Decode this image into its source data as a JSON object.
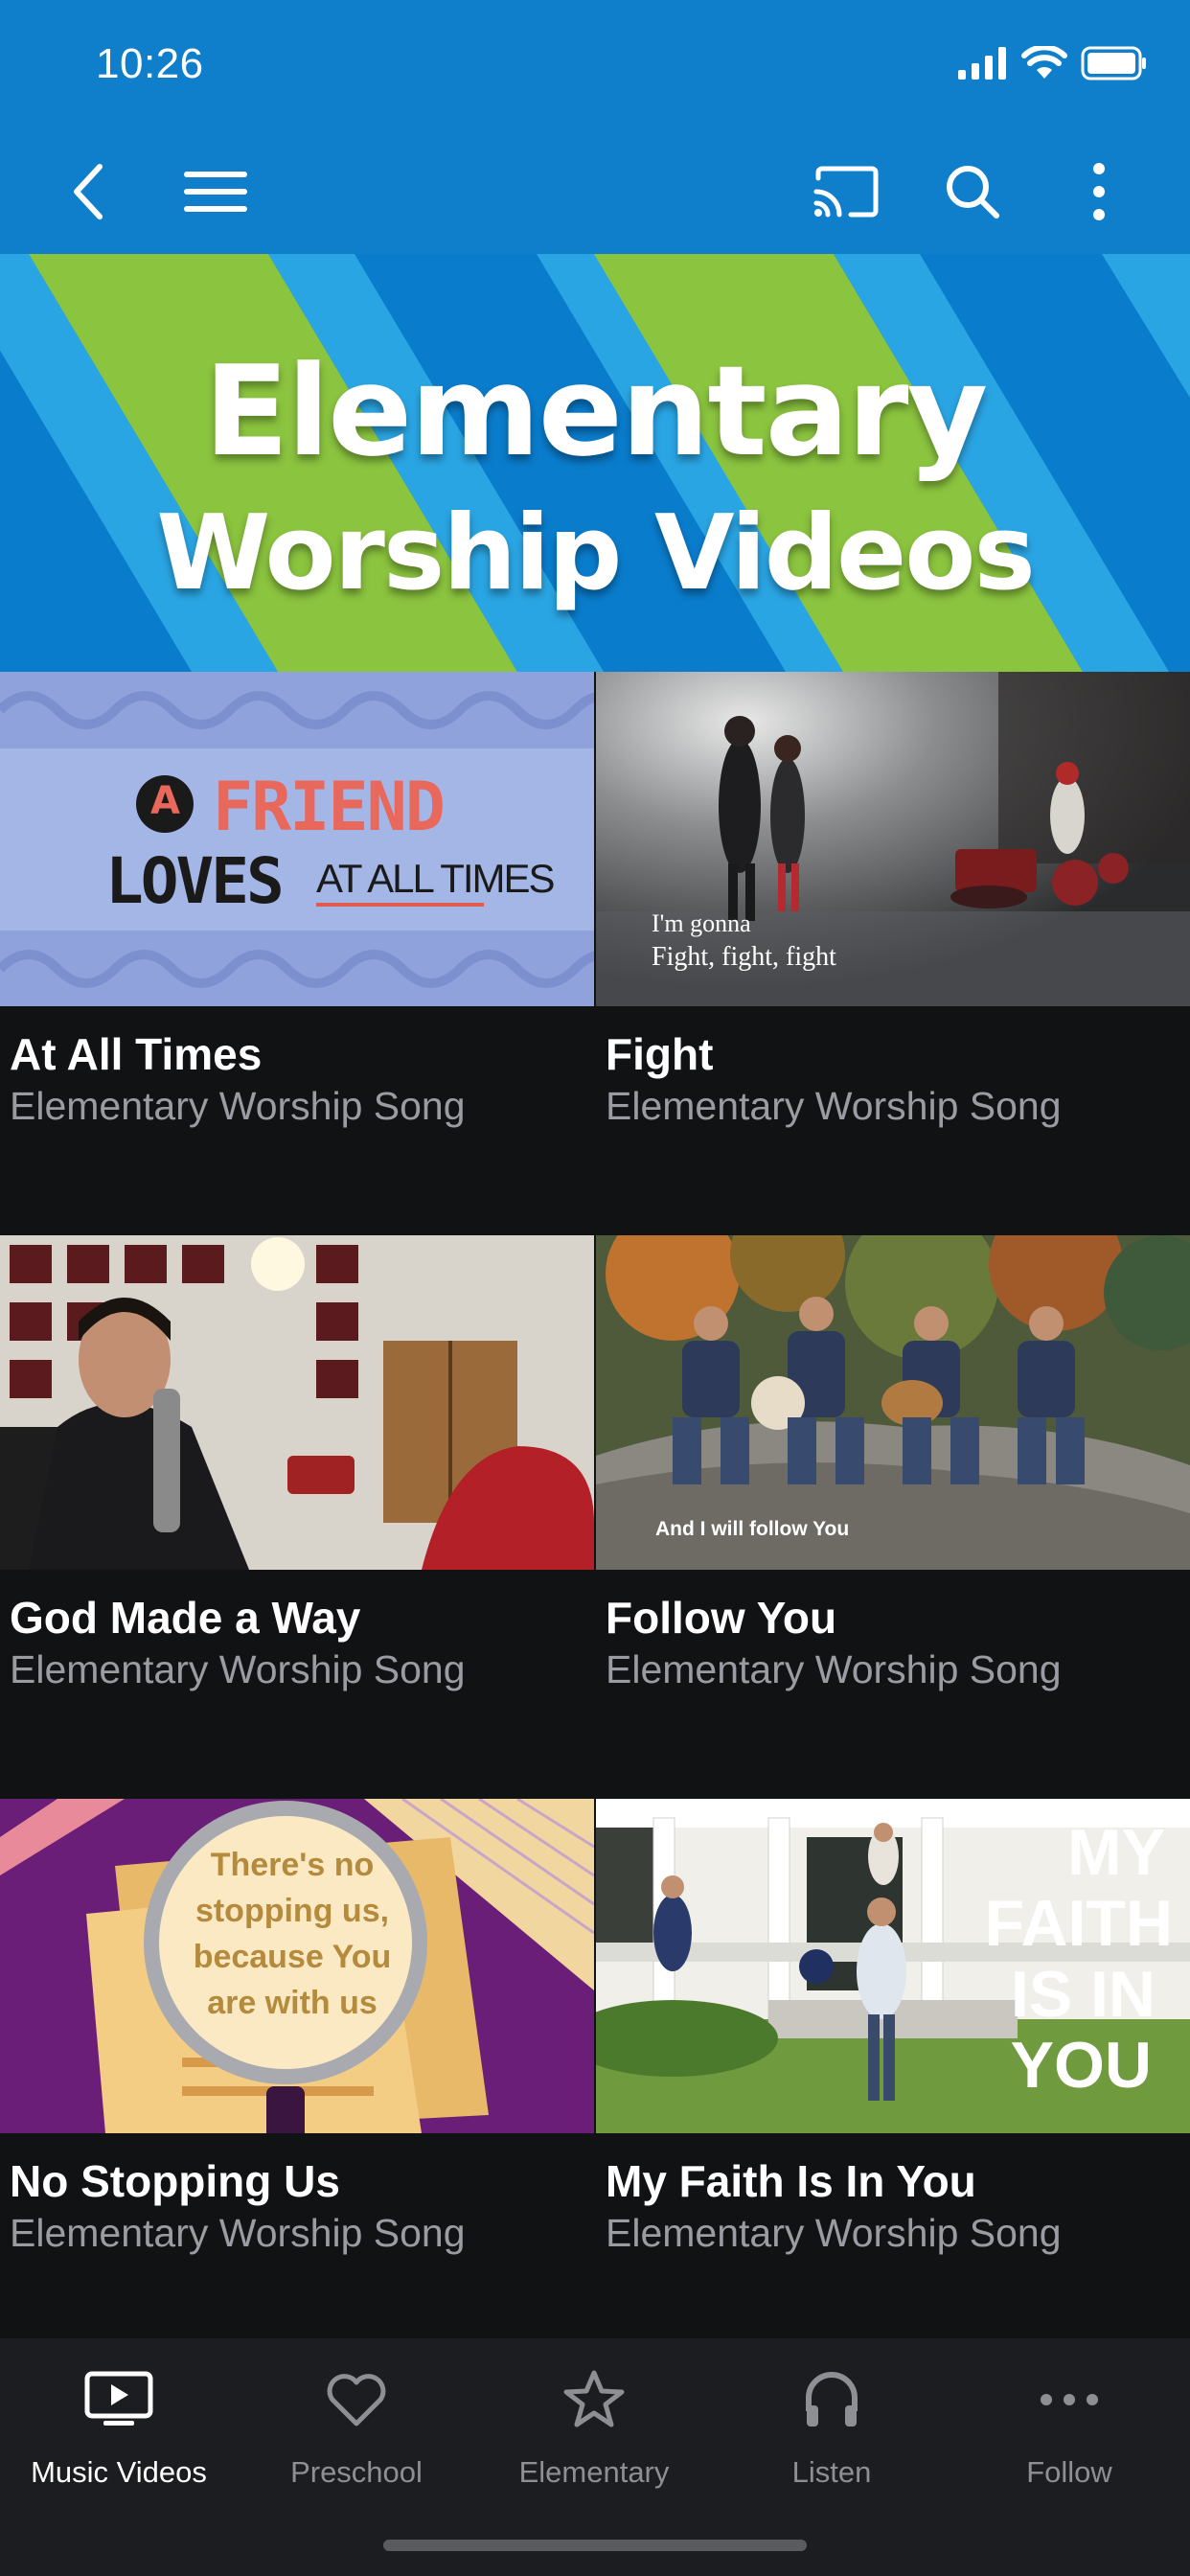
{
  "status_bar": {
    "time": "10:26"
  },
  "banner": {
    "line1": "Elementary",
    "line2": "Worship Videos"
  },
  "videos": [
    {
      "title": "At All Times",
      "subtitle": "Elementary Worship Song",
      "thumb_text_1": "A",
      "thumb_text_2": "FRIEND",
      "thumb_text_3": "LOVES",
      "thumb_text_4": "AT ALL TIMES"
    },
    {
      "title": "Fight",
      "subtitle": "Elementary Worship Song",
      "caption_1": "I'm gonna",
      "caption_2": "Fight, fight, fight"
    },
    {
      "title": "God Made a Way",
      "subtitle": "Elementary Worship Song"
    },
    {
      "title": "Follow You",
      "subtitle": "Elementary Worship Song",
      "caption": "And I will follow You"
    },
    {
      "title": "No Stopping Us",
      "subtitle": "Elementary Worship Song",
      "thumb_text_1": "There's no",
      "thumb_text_2": "stopping us,",
      "thumb_text_3": "because You",
      "thumb_text_4": "are with us"
    },
    {
      "title": "My Faith Is In You",
      "subtitle": "Elementary Worship Song",
      "thumb_text_1": "MY",
      "thumb_text_2": "FAITH",
      "thumb_text_3": "IS IN",
      "thumb_text_4": "YOU"
    }
  ],
  "tabs": [
    {
      "label": "Music Videos",
      "icon": "play-screen-icon",
      "active": true
    },
    {
      "label": "Preschool",
      "icon": "heart-icon",
      "active": false
    },
    {
      "label": "Elementary",
      "icon": "star-icon",
      "active": false
    },
    {
      "label": "Listen",
      "icon": "headphones-icon",
      "active": false
    },
    {
      "label": "Follow",
      "icon": "more-horizontal-icon",
      "active": false
    }
  ],
  "colors": {
    "header_blue": "#0f7fcb",
    "banner_green": "#8bc43f",
    "background": "#111214",
    "tabbar": "#1c1d20"
  }
}
